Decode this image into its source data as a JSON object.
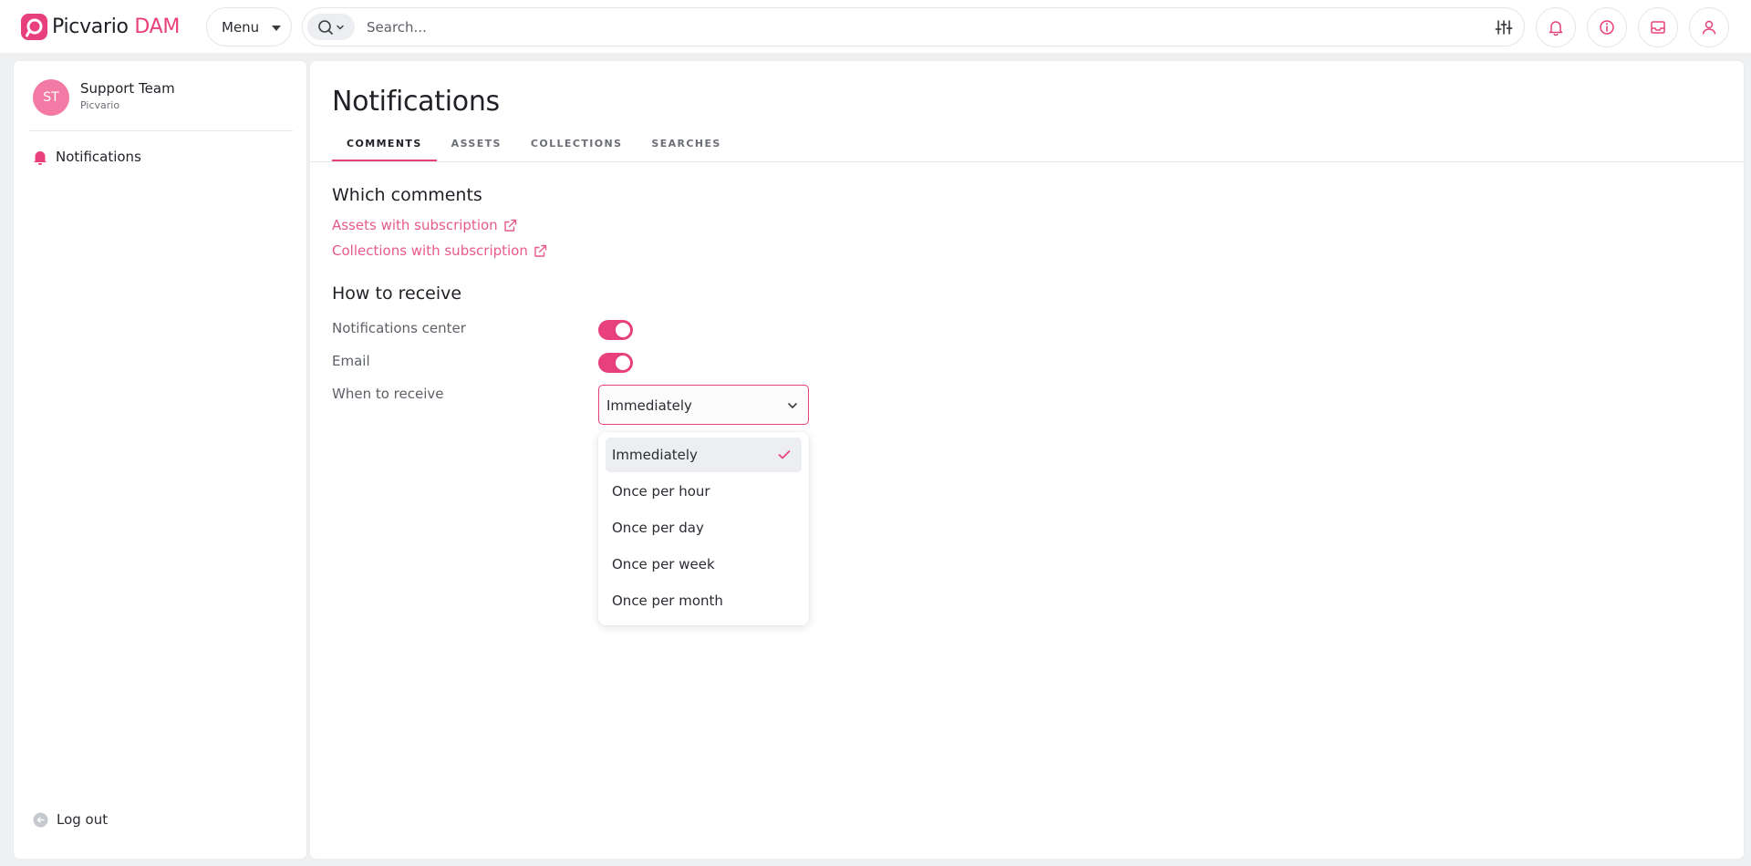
{
  "app": {
    "name": "Picvario",
    "name_accent": "DAM"
  },
  "header": {
    "menu_label": "Menu",
    "search_placeholder": "Search...",
    "icons": [
      "search-icon",
      "chevron-down-icon",
      "filter-sliders-icon",
      "bell-icon",
      "info-icon",
      "inbox-icon",
      "user-icon"
    ]
  },
  "sidebar": {
    "user": {
      "initials": "ST",
      "name": "Support Team",
      "org": "Picvario"
    },
    "items": [
      {
        "label": "Notifications",
        "icon": "bell-icon"
      }
    ],
    "logout_label": "Log out"
  },
  "main": {
    "title": "Notifications",
    "tabs": [
      {
        "label": "COMMENTS",
        "active": true
      },
      {
        "label": "ASSETS",
        "active": false
      },
      {
        "label": "COLLECTIONS",
        "active": false
      },
      {
        "label": "SEARCHES",
        "active": false
      }
    ],
    "which_comments": {
      "heading": "Which comments",
      "links": [
        "Assets with subscription",
        "Collections with subscription"
      ]
    },
    "how_to_receive": {
      "heading": "How to receive",
      "notifications_center_label": "Notifications center",
      "notifications_center_on": true,
      "email_label": "Email",
      "email_on": true,
      "when_label": "When to receive",
      "when_value": "Immediately"
    },
    "when_options": [
      "Immediately",
      "Once per hour",
      "Once per day",
      "Once per week",
      "Once per month"
    ]
  },
  "colors": {
    "accent": "#e8407c",
    "link": "#e8598d",
    "avatar": "#f27aa4",
    "background": "#eef0f2"
  }
}
